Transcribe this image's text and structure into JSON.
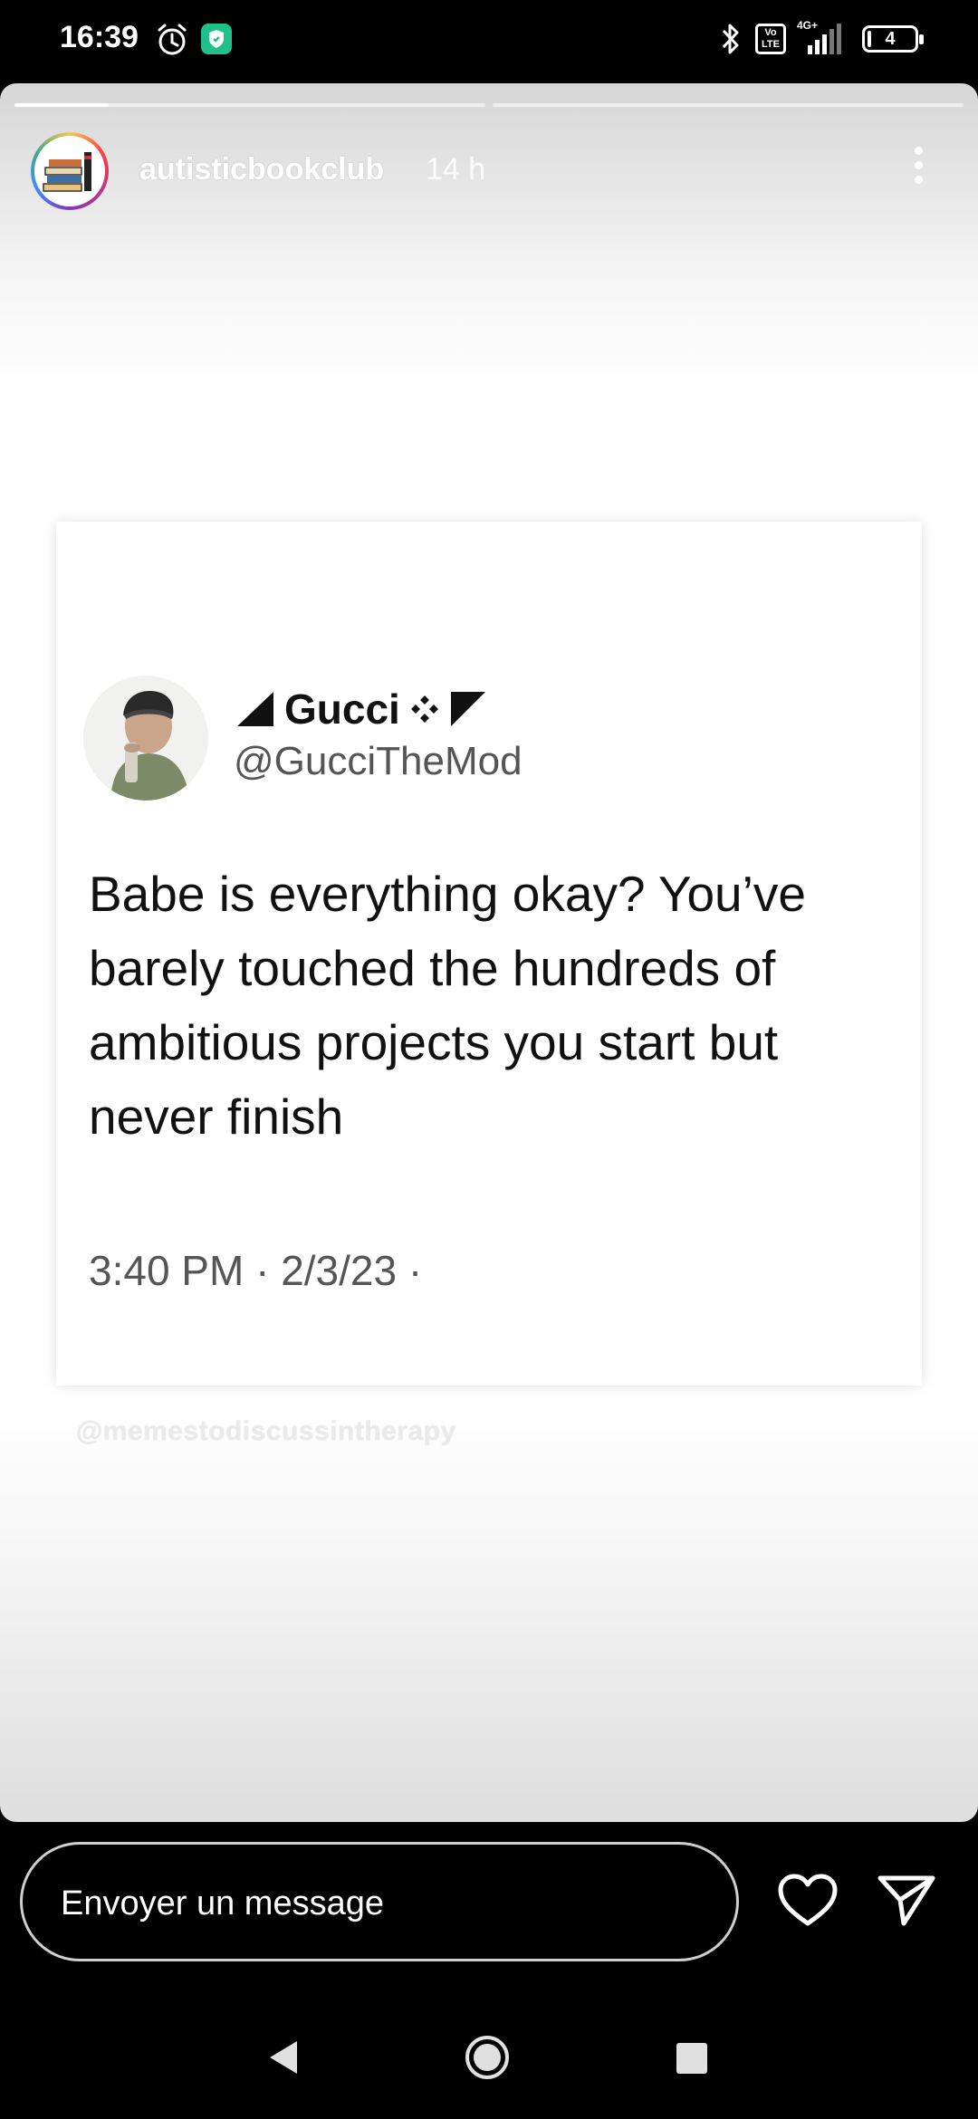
{
  "status_bar": {
    "time": "16:39",
    "volte": "Vo LTE",
    "network": "4G+",
    "battery": "4",
    "battery_level": 0.04,
    "icons": [
      "alarm-icon",
      "vpn-shield-icon",
      "bluetooth-icon",
      "volte-icon",
      "signal-icon",
      "battery-icon"
    ]
  },
  "story": {
    "username": "autisticbookclub",
    "time_ago": "14 h",
    "progress": [
      0.2,
      0.0
    ],
    "tweet": {
      "display_name": "Gucci",
      "handle": "@GucciTheMod",
      "text": "Babe is everything okay? You’ve barely touched the hundreds of ambitious projects you start but never finish",
      "timestamp": "3:40 PM · 2/3/23 ·"
    },
    "watermark": "@memestodiscussintherapy"
  },
  "reply_bar": {
    "placeholder": "Envoyer un message",
    "icons": [
      "heart-icon",
      "send-icon"
    ]
  },
  "nav_bar": {
    "icons": [
      "back-icon",
      "home-icon",
      "recents-icon"
    ]
  },
  "colors": {
    "shield_green": "#1fc08a",
    "background": "#000000",
    "card": "#ffffff"
  }
}
